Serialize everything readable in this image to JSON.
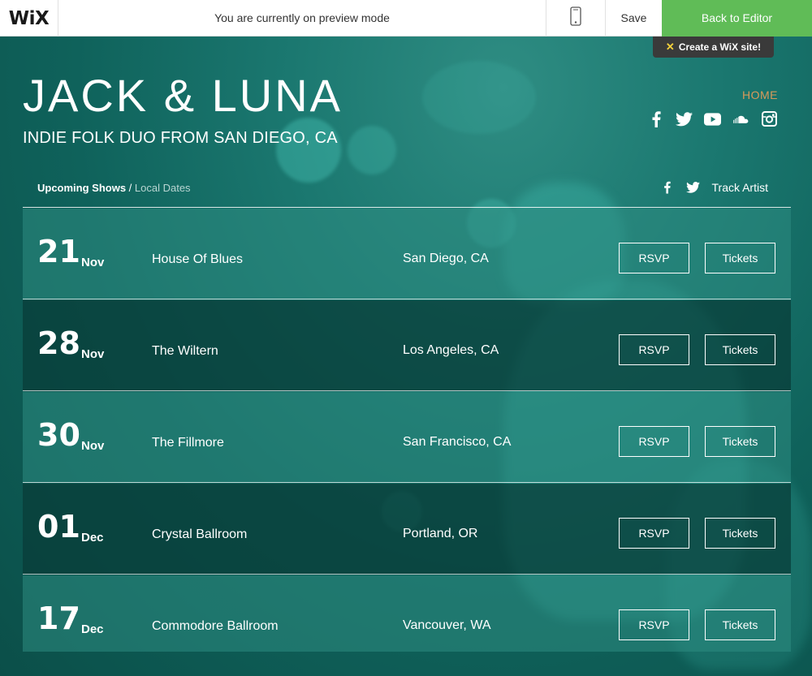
{
  "topbar": {
    "logo": "WiX",
    "preview_text": "You are currently on preview mode",
    "mobile_icon": "mobile-phone-icon",
    "save_label": "Save",
    "back_label": "Back to Editor"
  },
  "badge": {
    "text": "Create a WiX site!",
    "icon": "wix-star-icon"
  },
  "header": {
    "band_name": "JACK & LUNA",
    "tagline": "INDIE FOLK DUO FROM SAN DIEGO, CA",
    "nav_home": "HOME",
    "social_icons": [
      "facebook-icon",
      "twitter-icon",
      "youtube-icon",
      "soundcloud-icon",
      "instagram-icon"
    ]
  },
  "shows": {
    "title": "Upcoming Shows",
    "separator": " / ",
    "subtitle": "Local Dates",
    "share_icons": [
      "facebook-icon",
      "twitter-icon"
    ],
    "track_label": "Track Artist",
    "rows": [
      {
        "day": "21",
        "month": "Nov",
        "venue": "House Of Blues",
        "city": "San Diego, CA",
        "rsvp": "RSVP",
        "tickets": "Tickets"
      },
      {
        "day": "28",
        "month": "Nov",
        "venue": "The Wiltern",
        "city": "Los Angeles, CA",
        "rsvp": "RSVP",
        "tickets": "Tickets"
      },
      {
        "day": "30",
        "month": "Nov",
        "venue": "The Fillmore",
        "city": "San Francisco, CA",
        "rsvp": "RSVP",
        "tickets": "Tickets"
      },
      {
        "day": "01",
        "month": "Dec",
        "venue": "Crystal Ballroom",
        "city": "Portland, OR",
        "rsvp": "RSVP",
        "tickets": "Tickets"
      },
      {
        "day": "17",
        "month": "Dec",
        "venue": "Commodore Ballroom",
        "city": "Vancouver, WA",
        "rsvp": "RSVP",
        "tickets": "Tickets"
      }
    ]
  },
  "colors": {
    "accent_green": "#60bc57",
    "home_link": "#d89a5a",
    "background_teal": "#0e5e57"
  }
}
